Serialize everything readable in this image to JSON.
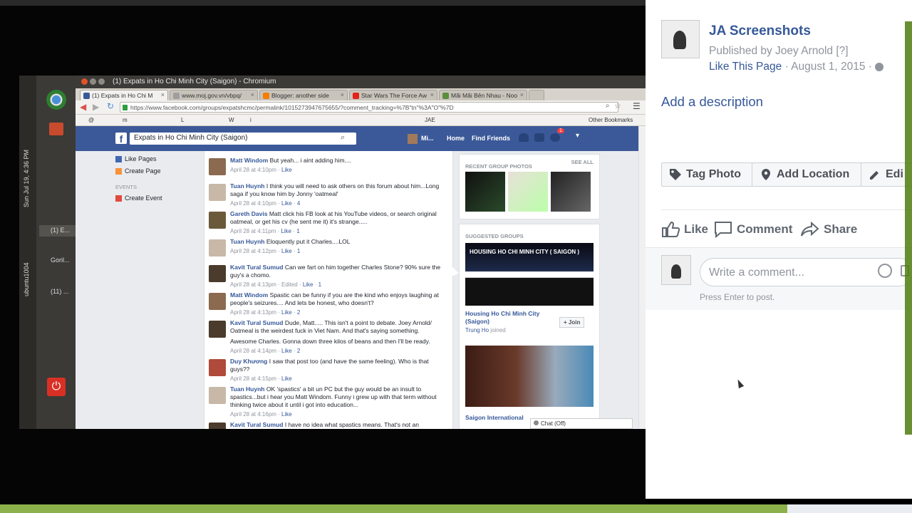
{
  "viewer": {
    "window_title": "(1) Expats in Ho Chi Minh City (Saigon) - Chromium",
    "launcher": {
      "clock": "Sun Jul 19, 4:36 PM",
      "user": "ubuntu1004",
      "windows": [
        {
          "label": "(1) E..."
        },
        {
          "label": "Goril..."
        },
        {
          "label": "(11) ..."
        }
      ]
    },
    "tabs": [
      {
        "label": "(1) Expats in Ho Chi M",
        "color": "#3b5998",
        "active": true
      },
      {
        "label": "www.moj.gov.vn/vbpq/",
        "color": "#9e9e9e",
        "active": false
      },
      {
        "label": "Blogger: another side",
        "color": "#f57d00",
        "active": false
      },
      {
        "label": "Star Wars The Force Aw",
        "color": "#e62117",
        "active": false
      },
      {
        "label": "Mãi Mãi Bên Nhau - Noo",
        "color": "#5a8f3c",
        "active": false
      }
    ],
    "url": "https://www.facebook.com/groups/expatshcmc/permalink/1015273947675655/?comment_tracking=%7B\"tn\"%3A\"O\"%7D",
    "other_bookmarks": "Other Bookmarks",
    "bookmarks": [
      "@",
      "m",
      "L",
      "W",
      "i",
      "JAE"
    ],
    "facebook": {
      "search": "Expats in Ho Chi Minh City (Saigon)",
      "user_short": "Mi...",
      "nav_home": "Home",
      "nav_find_friends": "Find Friends",
      "notif_count": "1",
      "left_links": [
        "Like Pages",
        "Create Page"
      ],
      "events_header": "EVENTS",
      "create_event": "Create Event",
      "comments": [
        {
          "name": "Matt Windom",
          "text": "But yeah... i aint adding him....",
          "meta": "April 28 at 4:10pm",
          "like": "Like",
          "likes": "",
          "color": "#8c6a4f"
        },
        {
          "name": "Tuan Huynh",
          "text": "I think you will need to ask others on this forum about him...Long saga if you know him by Jonny 'oatmeal'",
          "meta": "April 28 at 4:10pm",
          "like": "Like",
          "likes": "4",
          "color": "#c8b8a8"
        },
        {
          "name": "Gareth Davis",
          "text": "Matt click his FB look at his YouTube videos, or search original oatmeal, or get his cv (he sent me it) it's strange.....",
          "meta": "April 28 at 4:11pm",
          "like": "Like",
          "likes": "1",
          "color": "#6b5a3a"
        },
        {
          "name": "Tuan Huynh",
          "text": "Eloquently put it Charles....LOL",
          "meta": "April 28 at 4:12pm",
          "like": "Like",
          "likes": "1",
          "color": "#c8b8a8"
        },
        {
          "name": "Kavit Tural Sumud",
          "text": "Can we fart on him together Charles Stone? 90% sure the guy's a chomo.",
          "meta": "April 28 at 4:13pm · Edited",
          "like": "Like",
          "likes": "1",
          "color": "#4a3b2c"
        },
        {
          "name": "Matt Windom",
          "text": "Spastic can be funny if you are the kind who enjoys laughing at people's seizures.... And lets be honest, who doesn't?",
          "meta": "April 28 at 4:13pm",
          "like": "Like",
          "likes": "2",
          "color": "#8c6a4f"
        },
        {
          "name": "Kavit Tural Sumud",
          "text": "Dude, Matt..... This isn't a point to debate. Joey Arnold/ Oatmeal is the weirdest fuck in Viet Nam. And that's saying something.",
          "extra": "Awesome Charles. Gonna down three kilos of beans and then I'll be ready.",
          "meta": "April 28 at 4:14pm",
          "like": "Like",
          "likes": "2",
          "color": "#4a3b2c"
        },
        {
          "name": "Duy Khương",
          "text": "I saw that post too (and have the same feeling). Who is that guys??",
          "meta": "April 28 at 4:15pm",
          "like": "Like",
          "likes": "",
          "color": "#b04a3a"
        },
        {
          "name": "Tuan Huynh",
          "text": "OK 'spastics' a bit un PC but the guy would be an insult to spastics...but i hear you Matt Windom. Funny i grew up with that term without thinking twice about it until i got into education...",
          "meta": "April 28 at 4:16pm",
          "like": "Like",
          "likes": "",
          "color": "#c8b8a8"
        },
        {
          "name": "Kavit Tural Sumud",
          "text": "I have no idea what spastics means. That's not an",
          "meta": "",
          "like": "",
          "likes": "",
          "color": "#4a3b2c"
        }
      ],
      "recent_photos_header": "RECENT GROUP PHOTOS",
      "see_all": "SEE ALL",
      "suggested_header": "SUGGESTED GROUPS",
      "group1_banner": "HOUSING HO CHI MINH CITY ( SAIGON )",
      "group1_name": "Housing Ho Chi Minh City (Saigon)",
      "group1_member": "Trung Ho",
      "group1_member_suffix": "joined",
      "join": "+ Join",
      "group2_name": "Saigon International",
      "chat": "Chat (Off)"
    }
  },
  "panel": {
    "album_title": "JA Screenshots",
    "published_by": "Published by Joey Arnold [?]",
    "like_page": "Like This Page",
    "date": "· August 1, 2015 ·",
    "add_description": "Add a description",
    "buttons": {
      "tag": "Tag Photo",
      "location": "Add Location",
      "edit": "Edi"
    },
    "reactions": {
      "like": "Like",
      "comment": "Comment",
      "share": "Share"
    },
    "comment_placeholder": "Write a comment...",
    "press_enter": "Press Enter to post."
  }
}
